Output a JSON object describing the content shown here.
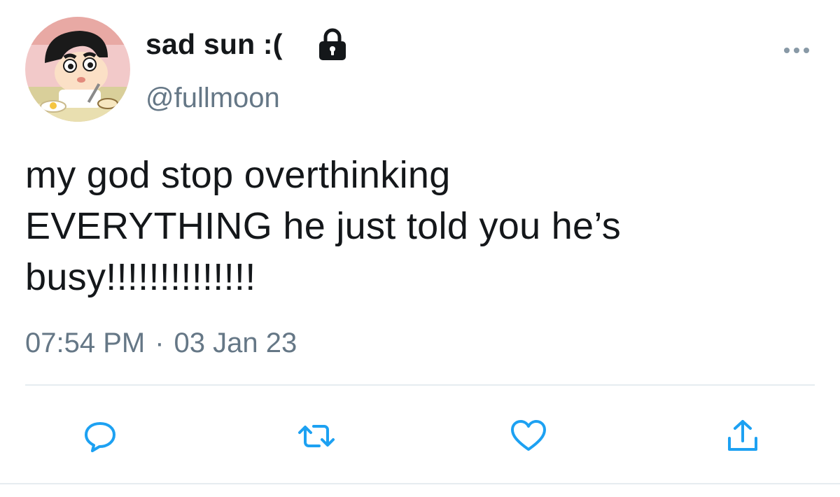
{
  "user": {
    "display_name": "sad sun :(",
    "handle": "@fullmoon",
    "protected": true,
    "avatar_icon": "cartoon-boy-avatar"
  },
  "tweet": {
    "text": "my god stop overthinking\nEVERYTHING he just told you he’s\nbusy!!!!!!!!!!!!!!",
    "time": "07:54 PM",
    "separator": "·",
    "date": "03 Jan 23"
  },
  "actions": {
    "reply_icon": "speech-bubble-icon",
    "retweet_icon": "retweet-icon",
    "like_icon": "heart-icon",
    "share_icon": "share-icon",
    "more_icon": "ellipsis-icon"
  },
  "colors": {
    "text": "#14171a",
    "secondary": "#657786",
    "accent": "#1da1f2",
    "divider": "#e6ecf0"
  }
}
